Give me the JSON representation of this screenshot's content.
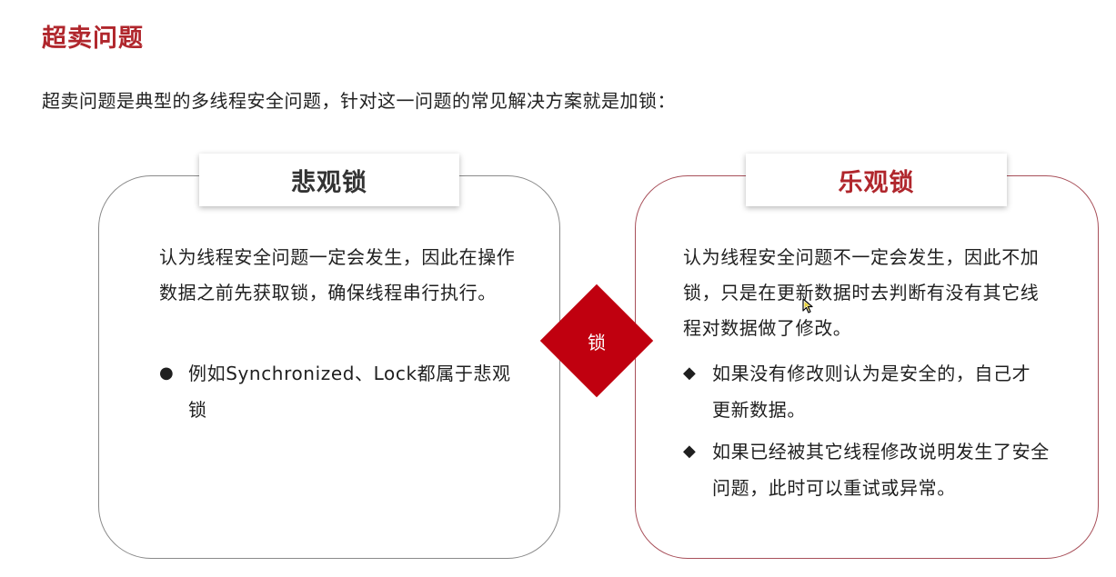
{
  "page": {
    "title": "超卖问题",
    "intro": "超卖问题是典型的多线程安全问题，针对这一问题的常见解决方案就是加锁："
  },
  "center": {
    "label": "锁",
    "color": "#c0000f"
  },
  "pessimistic": {
    "heading": "悲观锁",
    "description": "认为线程安全问题一定会发生，因此在操作数据之前先获取锁，确保线程串行执行。",
    "bullet_marker": "●",
    "bullets": [
      "例如Synchronized、Lock都属于悲观锁"
    ]
  },
  "optimistic": {
    "heading": "乐观锁",
    "heading_color": "#b0262c",
    "description": "认为线程安全问题不一定会发生，因此不加锁，只是在更新数据时去判断有没有其它线程对数据做了修改。",
    "bullet_marker": "◆",
    "bullets": [
      "如果没有修改则认为是安全的，自己才更新数据。",
      "如果已经被其它线程修改说明发生了安全问题，此时可以重试或异常。"
    ]
  },
  "icons": {
    "cursor": "mouse-pointer-icon"
  }
}
